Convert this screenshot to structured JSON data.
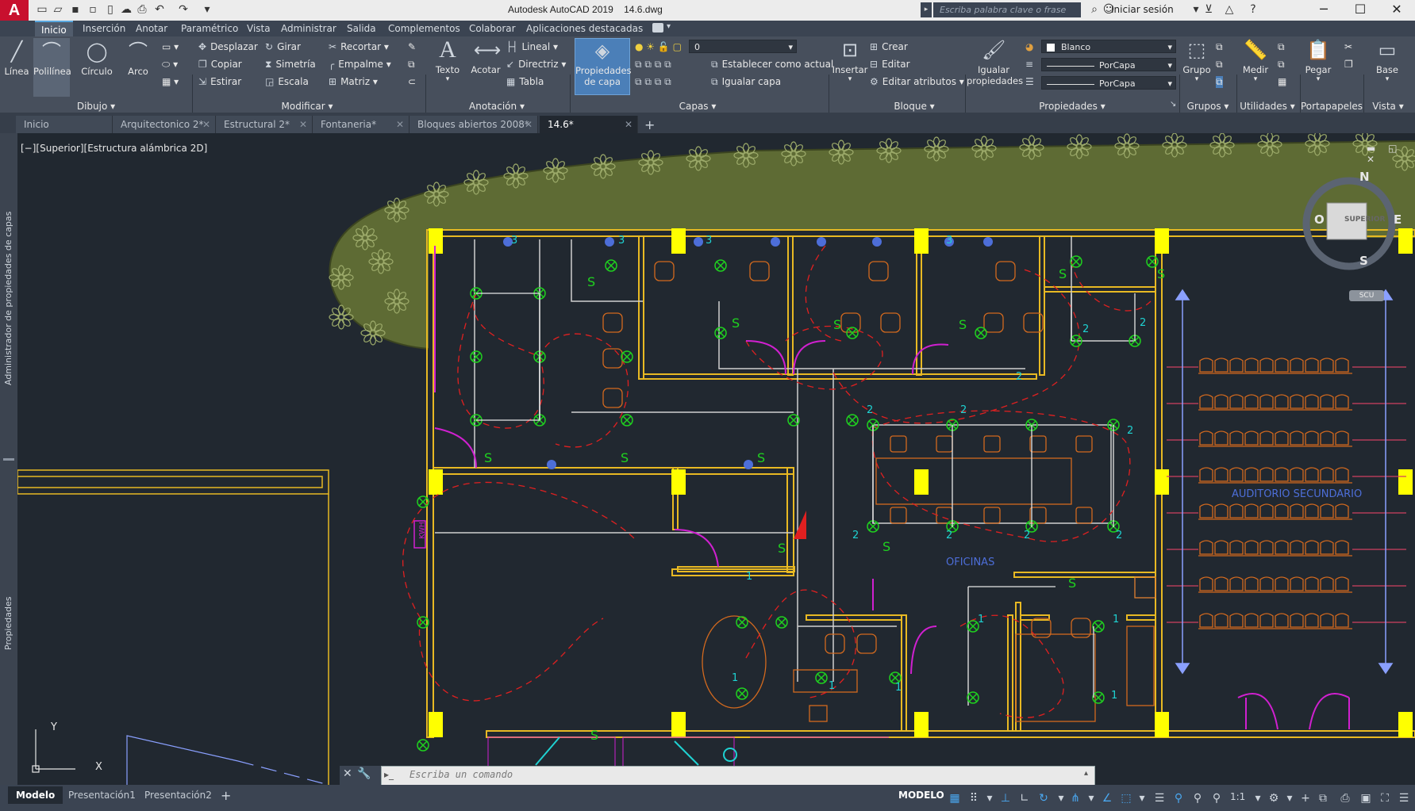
{
  "titlebar": {
    "app_title": "Autodesk AutoCAD 2019",
    "file_name": "14.6.dwg",
    "search_placeholder": "Escriba palabra clave o frase",
    "signin_label": "Iniciar sesión",
    "minimize": "─",
    "maximize": "☐",
    "close": "✕",
    "logo": "A"
  },
  "menu_tabs": [
    "Inicio",
    "Inserción",
    "Anotar",
    "Paramétrico",
    "Vista",
    "Administrar",
    "Salida",
    "Complementos",
    "Colaborar",
    "Aplicaciones destacadas"
  ],
  "ribbon": {
    "dibujo": {
      "title": "Dibujo",
      "linea": "Línea",
      "polilinea": "Polilínea",
      "circulo": "Círculo",
      "arco": "Arco"
    },
    "modificar": {
      "title": "Modificar",
      "desplazar": "Desplazar",
      "girar": "Girar",
      "recortar": "Recortar",
      "copiar": "Copiar",
      "simetria": "Simetría",
      "empalme": "Empalme",
      "estirar": "Estirar",
      "escala": "Escala",
      "matriz": "Matriz"
    },
    "anotacion": {
      "title": "Anotación",
      "texto": "Texto",
      "acotar": "Acotar",
      "lineal": "Lineal",
      "directriz": "Directriz",
      "tabla": "Tabla"
    },
    "capas": {
      "title": "Capas",
      "propiedades_capa_1": "Propiedades",
      "propiedades_capa_2": "de capa",
      "layer_value": "0",
      "establecer": "Establecer como actual",
      "igualar": "Igualar capa"
    },
    "bloque": {
      "title": "Bloque",
      "insertar": "Insertar",
      "crear": "Crear",
      "editar": "Editar",
      "editar_atributos": "Editar atributos"
    },
    "propiedades": {
      "title": "Propiedades",
      "igualar_1": "Igualar",
      "igualar_2": "propiedades",
      "color_value": "Blanco",
      "linetype_value": "PorCapa",
      "lineweight_value": "PorCapa"
    },
    "grupos": {
      "title": "Grupos",
      "grupo": "Grupo"
    },
    "utilidades": {
      "title": "Utilidades",
      "medir": "Medir"
    },
    "portapapeles": {
      "title": "Portapapeles",
      "pegar": "Pegar"
    },
    "vista": {
      "title": "Vista",
      "base": "Base"
    }
  },
  "doc_tabs": [
    {
      "label": "Inicio"
    },
    {
      "label": "Arquitectonico 2*"
    },
    {
      "label": "Estructural 2*"
    },
    {
      "label": "Fontaneria*"
    },
    {
      "label": "Bloques abiertos 2008*"
    },
    {
      "label": "14.6*"
    }
  ],
  "palettes": {
    "capas_label": "Administrador de propiedades de capas",
    "propiedades_label": "Propiedades"
  },
  "viewport": {
    "label": "[−][Superior][Estructura alámbrica 2D]",
    "viewcube_top": "SUPERIOR",
    "compass_n": "N",
    "compass_s": "S",
    "compass_e": "E",
    "compass_o": "O",
    "ucs_label": "SCU",
    "axis_x": "X",
    "axis_y": "Y"
  },
  "drawing_labels": {
    "auditorio": "AUDITORIO SECUNDARIO",
    "oficinas": "OFICINAS",
    "kwh": "KWH",
    "circuit_2": "2",
    "circuit_1": "1",
    "circuit_3": "3",
    "switch": "S"
  },
  "command": {
    "placeholder": "Escriba un comando"
  },
  "status": {
    "layouts": [
      "Modelo",
      "Presentación1",
      "Presentación2"
    ],
    "modelo": "MODELO",
    "scale": "1:1"
  },
  "colors": {
    "wall": "#e8b923",
    "column": "#ffff00",
    "circuit": "#e02020",
    "fixture": "#1fd21f",
    "furniture": "#d2691e",
    "door": "#d020d0",
    "partition": "#d0d0d0",
    "tree": "#6b7a3a",
    "blue_text": "#4d6ed8"
  }
}
